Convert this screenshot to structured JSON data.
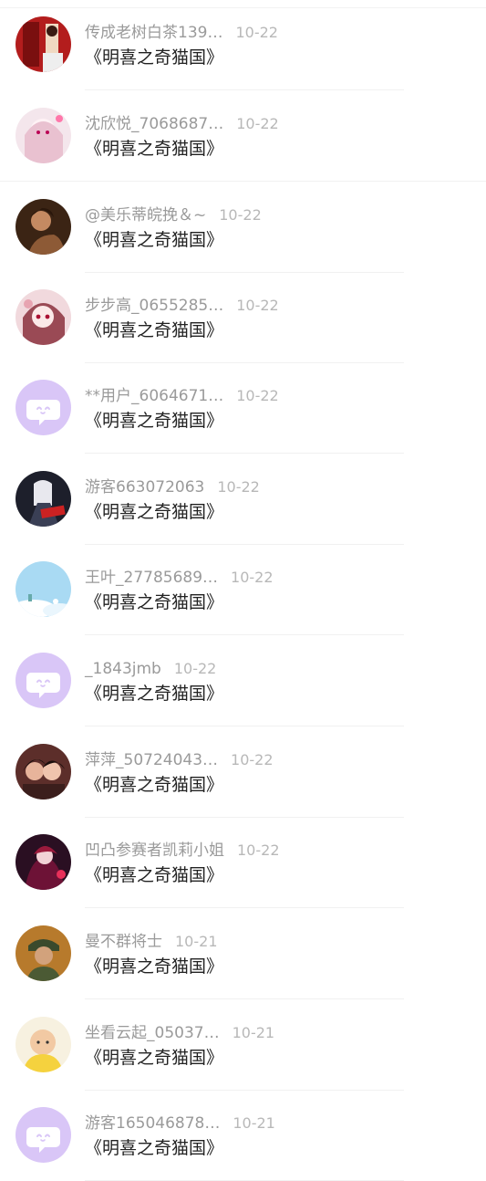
{
  "colors": {
    "default_avatar_bg": "#d9c6f7",
    "default_avatar_icon": "#ffffff",
    "name_text": "#9a9a9a",
    "date_text": "#b8b8b8",
    "message_text": "#222222"
  },
  "messages": [
    {
      "name": "传成老树白茶139…",
      "date": "10-22",
      "text": "《明喜之奇猫国》",
      "avatar": "photo-red"
    },
    {
      "name": "沈欣悦_7068687…",
      "date": "10-22",
      "text": "《明喜之奇猫国》",
      "avatar": "anime-pink"
    },
    {
      "name": "@美乐蒂皖挽＆~",
      "date": "10-22",
      "text": "《明喜之奇猫国》",
      "avatar": "photo-dark"
    },
    {
      "name": "步步高_0655285…",
      "date": "10-22",
      "text": "《明喜之奇猫国》",
      "avatar": "anime-pink2"
    },
    {
      "name": "**用户_6064671…",
      "date": "10-22",
      "text": "《明喜之奇猫国》",
      "avatar": "default-chat"
    },
    {
      "name": "游客663072063",
      "date": "10-22",
      "text": "《明喜之奇猫国》",
      "avatar": "anime-dark"
    },
    {
      "name": "王叶_27785689…",
      "date": "10-22",
      "text": "《明喜之奇猫国》",
      "avatar": "sky-blue"
    },
    {
      "name": "_1843jmb",
      "date": "10-22",
      "text": "《明喜之奇猫国》",
      "avatar": "default-chat"
    },
    {
      "name": "萍萍_50724043…",
      "date": "10-22",
      "text": "《明喜之奇猫国》",
      "avatar": "photo-couple"
    },
    {
      "name": "凹凸参赛者凯莉小姐",
      "date": "10-22",
      "text": "《明喜之奇猫国》",
      "avatar": "anime-red"
    },
    {
      "name": "曼不群将士",
      "date": "10-21",
      "text": "《明喜之奇猫国》",
      "avatar": "photo-soldier"
    },
    {
      "name": "坐看云起_05037…",
      "date": "10-21",
      "text": "《明喜之奇猫国》",
      "avatar": "photo-baby"
    },
    {
      "name": "游客165046878…",
      "date": "10-21",
      "text": "《明喜之奇猫国》",
      "avatar": "default-chat"
    }
  ]
}
